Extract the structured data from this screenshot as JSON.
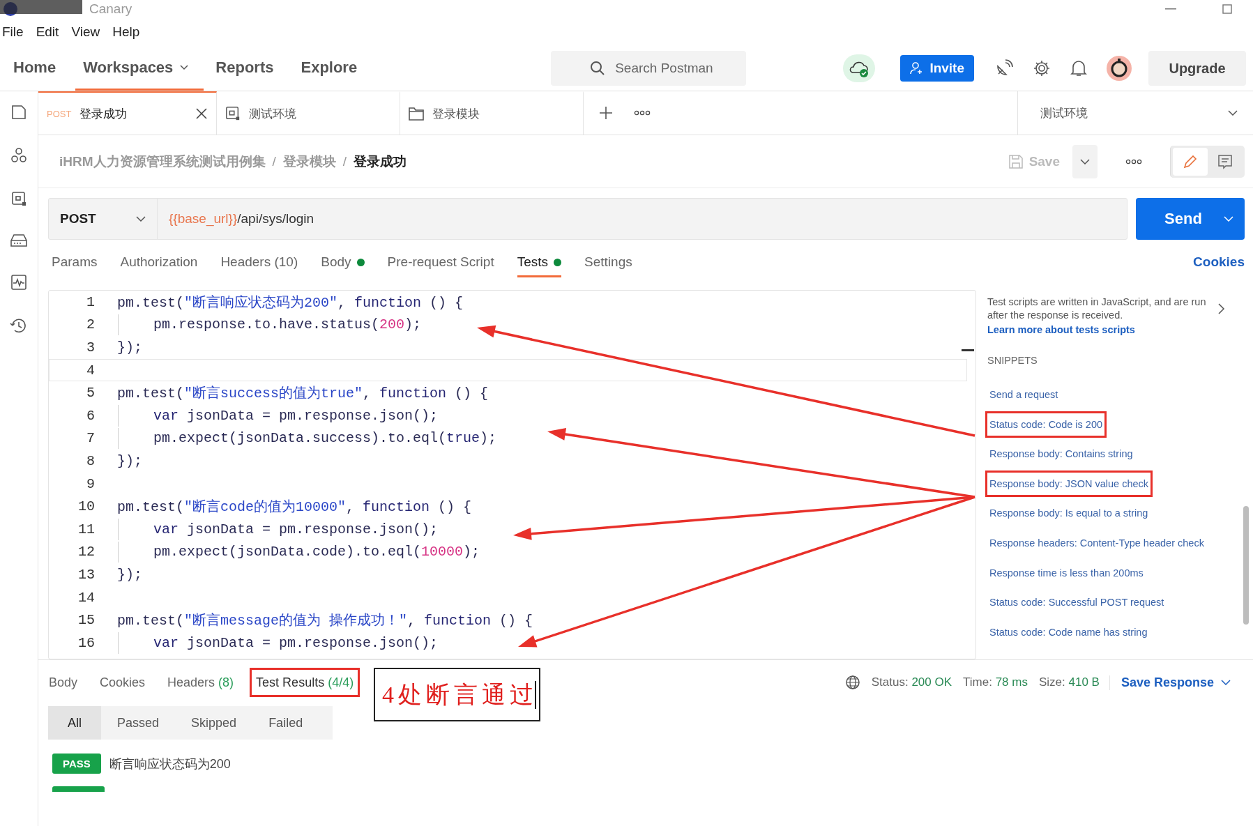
{
  "title_bar": {
    "title": "Canary"
  },
  "menu": [
    "File",
    "Edit",
    "View",
    "Help"
  ],
  "nav": [
    {
      "label": "Home",
      "selected": false,
      "dropdown": false
    },
    {
      "label": "Workspaces",
      "selected": true,
      "dropdown": true
    },
    {
      "label": "Reports",
      "selected": false,
      "dropdown": false
    },
    {
      "label": "Explore",
      "selected": false,
      "dropdown": false
    }
  ],
  "search": {
    "placeholder": "Search Postman"
  },
  "invite_button": "Invite",
  "upgrade_button": "Upgrade",
  "open_tabs": [
    {
      "kind": "request",
      "method": "POST",
      "label": "登录成功",
      "selected": true
    },
    {
      "kind": "environment",
      "label": "测试环境",
      "selected": false
    },
    {
      "kind": "folder",
      "label": "登录模块",
      "selected": false
    }
  ],
  "environment_select": "测试环境",
  "breadcrumb_separator": "/",
  "breadcrumb": [
    "iHRM人力资源管理系统测试用例集",
    "登录模块",
    "登录成功"
  ],
  "save_button": "Save",
  "request": {
    "method": "POST",
    "url_variable": "{{base_url}}",
    "url_path": "/api/sys/login",
    "send_button": "Send"
  },
  "request_tabs": [
    {
      "label": "Params",
      "selected": false,
      "dot": false
    },
    {
      "label": "Authorization",
      "selected": false,
      "dot": false
    },
    {
      "label": "Headers (10)",
      "selected": false,
      "dot": false
    },
    {
      "label": "Body",
      "selected": false,
      "dot": true
    },
    {
      "label": "Pre-request Script",
      "selected": false,
      "dot": false
    },
    {
      "label": "Tests",
      "selected": true,
      "dot": true
    },
    {
      "label": "Settings",
      "selected": false,
      "dot": false
    }
  ],
  "cookies_link": "Cookies",
  "editor": {
    "lines": [
      {
        "number": "1",
        "indented": false,
        "selected": false,
        "tokens": [
          {
            "kind": "plain",
            "text": "pm.test("
          },
          {
            "kind": "str",
            "text": "\"断言响应状态码为200\""
          },
          {
            "kind": "plain",
            "text": ", "
          },
          {
            "kind": "kw",
            "text": "function"
          },
          {
            "kind": "plain",
            "text": " () {"
          }
        ]
      },
      {
        "number": "2",
        "indented": true,
        "selected": false,
        "tokens": [
          {
            "kind": "plain",
            "text": "pm.response.to.have.status("
          },
          {
            "kind": "num",
            "text": "200"
          },
          {
            "kind": "plain",
            "text": ");"
          }
        ]
      },
      {
        "number": "3",
        "indented": false,
        "selected": false,
        "tokens": [
          {
            "kind": "plain",
            "text": "});"
          }
        ]
      },
      {
        "number": "4",
        "indented": false,
        "selected": true
      },
      {
        "number": "5",
        "indented": false,
        "selected": false,
        "tokens": [
          {
            "kind": "plain",
            "text": "pm.test("
          },
          {
            "kind": "str",
            "text": "\"断言success的值为true\""
          },
          {
            "kind": "plain",
            "text": ", "
          },
          {
            "kind": "kw",
            "text": "function"
          },
          {
            "kind": "plain",
            "text": " () {"
          }
        ]
      },
      {
        "number": "6",
        "indented": true,
        "selected": false,
        "tokens": [
          {
            "kind": "kw",
            "text": "var"
          },
          {
            "kind": "plain",
            "text": " jsonData = pm.response.json();"
          }
        ]
      },
      {
        "number": "7",
        "indented": true,
        "selected": false,
        "tokens": [
          {
            "kind": "plain",
            "text": "pm.expect(jsonData.success).to.eql("
          },
          {
            "kind": "kw",
            "text": "true"
          },
          {
            "kind": "plain",
            "text": ");"
          }
        ]
      },
      {
        "number": "8",
        "indented": false,
        "selected": false,
        "tokens": [
          {
            "kind": "plain",
            "text": "});"
          }
        ]
      },
      {
        "number": "9",
        "indented": false,
        "selected": false
      },
      {
        "number": "10",
        "indented": false,
        "selected": false,
        "tokens": [
          {
            "kind": "plain",
            "text": "pm.test("
          },
          {
            "kind": "str",
            "text": "\"断言code的值为10000\""
          },
          {
            "kind": "plain",
            "text": ", "
          },
          {
            "kind": "kw",
            "text": "function"
          },
          {
            "kind": "plain",
            "text": " () {"
          }
        ]
      },
      {
        "number": "11",
        "indented": true,
        "selected": false,
        "tokens": [
          {
            "kind": "kw",
            "text": "var"
          },
          {
            "kind": "plain",
            "text": " jsonData = pm.response.json();"
          }
        ]
      },
      {
        "number": "12",
        "indented": true,
        "selected": false,
        "tokens": [
          {
            "kind": "plain",
            "text": "pm.expect(jsonData.code).to.eql("
          },
          {
            "kind": "num",
            "text": "10000"
          },
          {
            "kind": "plain",
            "text": ");"
          }
        ]
      },
      {
        "number": "13",
        "indented": false,
        "selected": false,
        "tokens": [
          {
            "kind": "plain",
            "text": "});"
          }
        ]
      },
      {
        "number": "14",
        "indented": false,
        "selected": false
      },
      {
        "number": "15",
        "indented": false,
        "selected": false,
        "tokens": [
          {
            "kind": "plain",
            "text": "pm.test("
          },
          {
            "kind": "str",
            "text": "\"断言message的值为 操作成功！\""
          },
          {
            "kind": "plain",
            "text": ", "
          },
          {
            "kind": "kw",
            "text": "function"
          },
          {
            "kind": "plain",
            "text": " () {"
          }
        ]
      },
      {
        "number": "16",
        "indented": true,
        "selected": false,
        "tokens": [
          {
            "kind": "kw",
            "text": "var"
          },
          {
            "kind": "plain",
            "text": " jsonData = pm.response.json();"
          }
        ]
      }
    ]
  },
  "snippets": {
    "description": "Test scripts are written in JavaScript, and are run after the response is received.",
    "link": "Learn more about tests scripts",
    "heading": "SNIPPETS",
    "items": [
      {
        "label": "Send a request",
        "highlighted": false
      },
      {
        "label": "Status code: Code is 200",
        "highlighted": true
      },
      {
        "label": "Response body: Contains string",
        "highlighted": false
      },
      {
        "label": "Response body: JSON value check",
        "highlighted": true
      },
      {
        "label": "Response body: Is equal to a string",
        "highlighted": false
      },
      {
        "label": "Response headers: Content-Type header check",
        "highlighted": false
      },
      {
        "label": "Response time is less than 200ms",
        "highlighted": false
      },
      {
        "label": "Status code: Successful POST request",
        "highlighted": false
      },
      {
        "label": "Status code: Code name has string",
        "highlighted": false
      }
    ]
  },
  "response": {
    "tabs": [
      {
        "label": "Body",
        "selected": false,
        "highlighted": false
      },
      {
        "label": "Cookies",
        "selected": false,
        "highlighted": false
      },
      {
        "label": "Headers",
        "count": "(8)",
        "selected": false,
        "highlighted": false
      },
      {
        "label": "Test Results",
        "count": "(4/4)",
        "selected": true,
        "highlighted": true
      }
    ],
    "status_label": "Status:",
    "status_value": "200 OK",
    "time_label": "Time:",
    "time_value": "78 ms",
    "size_label": "Size:",
    "size_value": "410 B",
    "save_response": "Save Response"
  },
  "annotation_note": "4处断言通过",
  "filters": [
    {
      "label": "All",
      "selected": true
    },
    {
      "label": "Passed",
      "selected": false
    },
    {
      "label": "Skipped",
      "selected": false
    },
    {
      "label": "Failed",
      "selected": false
    }
  ],
  "results": [
    {
      "status": "PASS",
      "name": "断言响应状态码为200"
    }
  ]
}
